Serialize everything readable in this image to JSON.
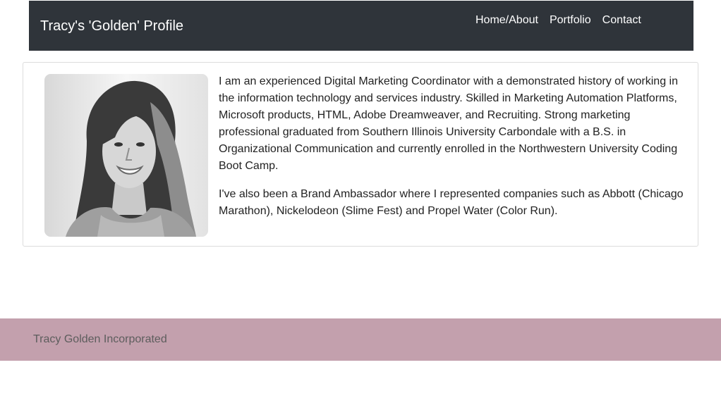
{
  "header": {
    "brand": "Tracy's 'Golden' Profile",
    "nav": [
      {
        "label": "Home/About"
      },
      {
        "label": "Portfolio"
      },
      {
        "label": "Contact"
      }
    ]
  },
  "profile": {
    "paragraphs": [
      "I am an experienced Digital Marketing Coordinator with a demonstrated history of working in the information technology and services industry. Skilled in Marketing Automation Platforms, Microsoft products, HTML, Adobe Dreamweaver, and Recruiting. Strong marketing professional graduated from Southern Illinois University Carbondale with a B.S. in Organizational Communication and currently enrolled in the Northwestern University Coding Boot Camp.",
      "I've also been a Brand Ambassador where I represented companies such as Abbott (Chicago Marathon), Nickelodeon (Slime Fest) and Propel Water (Color Run)."
    ]
  },
  "footer": {
    "text": "Tracy Golden Incorporated"
  },
  "colors": {
    "navbar": "#2f343a",
    "footer": "#c3a0ad",
    "footer_text": "#5d5d5d"
  }
}
